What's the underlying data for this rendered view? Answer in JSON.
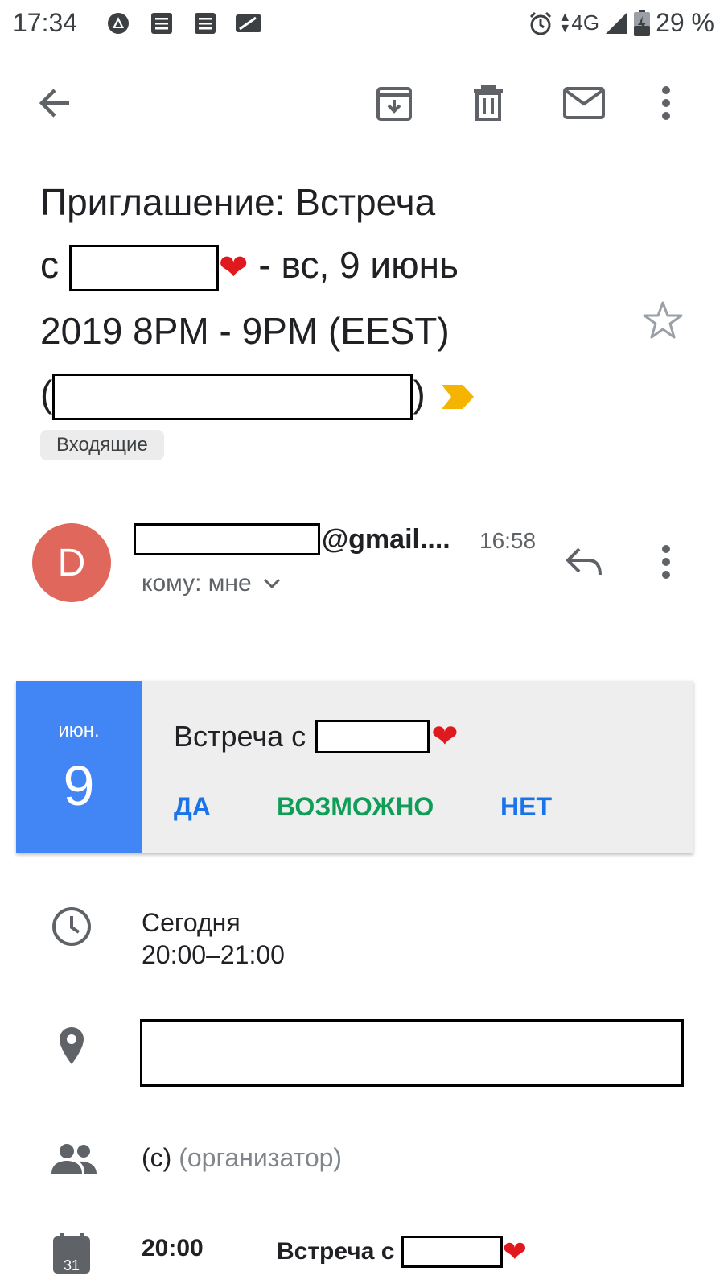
{
  "status_bar": {
    "time": "17:34",
    "network": "4G",
    "battery": "29 %",
    "icons": [
      "notification-app-icon",
      "doc-icon",
      "doc-icon",
      "tablet-icon",
      "alarm-icon",
      "signal-icon",
      "battery-icon"
    ]
  },
  "toolbar": {
    "icons": [
      "back-arrow-icon",
      "archive-icon",
      "delete-icon",
      "mark-unread-icon",
      "more-vert-icon"
    ]
  },
  "email": {
    "subject_part1": "Приглашение: Встреча",
    "subject_prefix_line2": "с ",
    "subject_after_heart": " - вс, 9 июнь",
    "subject_line3": "2019 8PM - 9PM (EEST)",
    "subject_open_paren": "(",
    "subject_close_paren": ")",
    "label": "Входящие",
    "heart": "❤"
  },
  "sender": {
    "avatar_letter": "D",
    "domain": "@gmail....",
    "time": "16:58",
    "recipient": "кому: мне"
  },
  "invite": {
    "month": "июн.",
    "day": "9",
    "title": "Встреча с ",
    "yes": "ДА",
    "maybe": "ВОЗМОЖНО",
    "no": "НЕТ",
    "colors": {
      "date_bg": "#4285f4",
      "yes": "#1a73e8",
      "maybe": "#0f9d58",
      "no": "#1a73e8"
    }
  },
  "details": {
    "when_day": "Сегодня",
    "when_time": "20:00–21:00",
    "organizer_prefix": "(с)",
    "organizer_role": "(организатор)",
    "calendar_icon_day": "31",
    "agenda_time": "20:00",
    "agenda_title": "Встреча с "
  }
}
